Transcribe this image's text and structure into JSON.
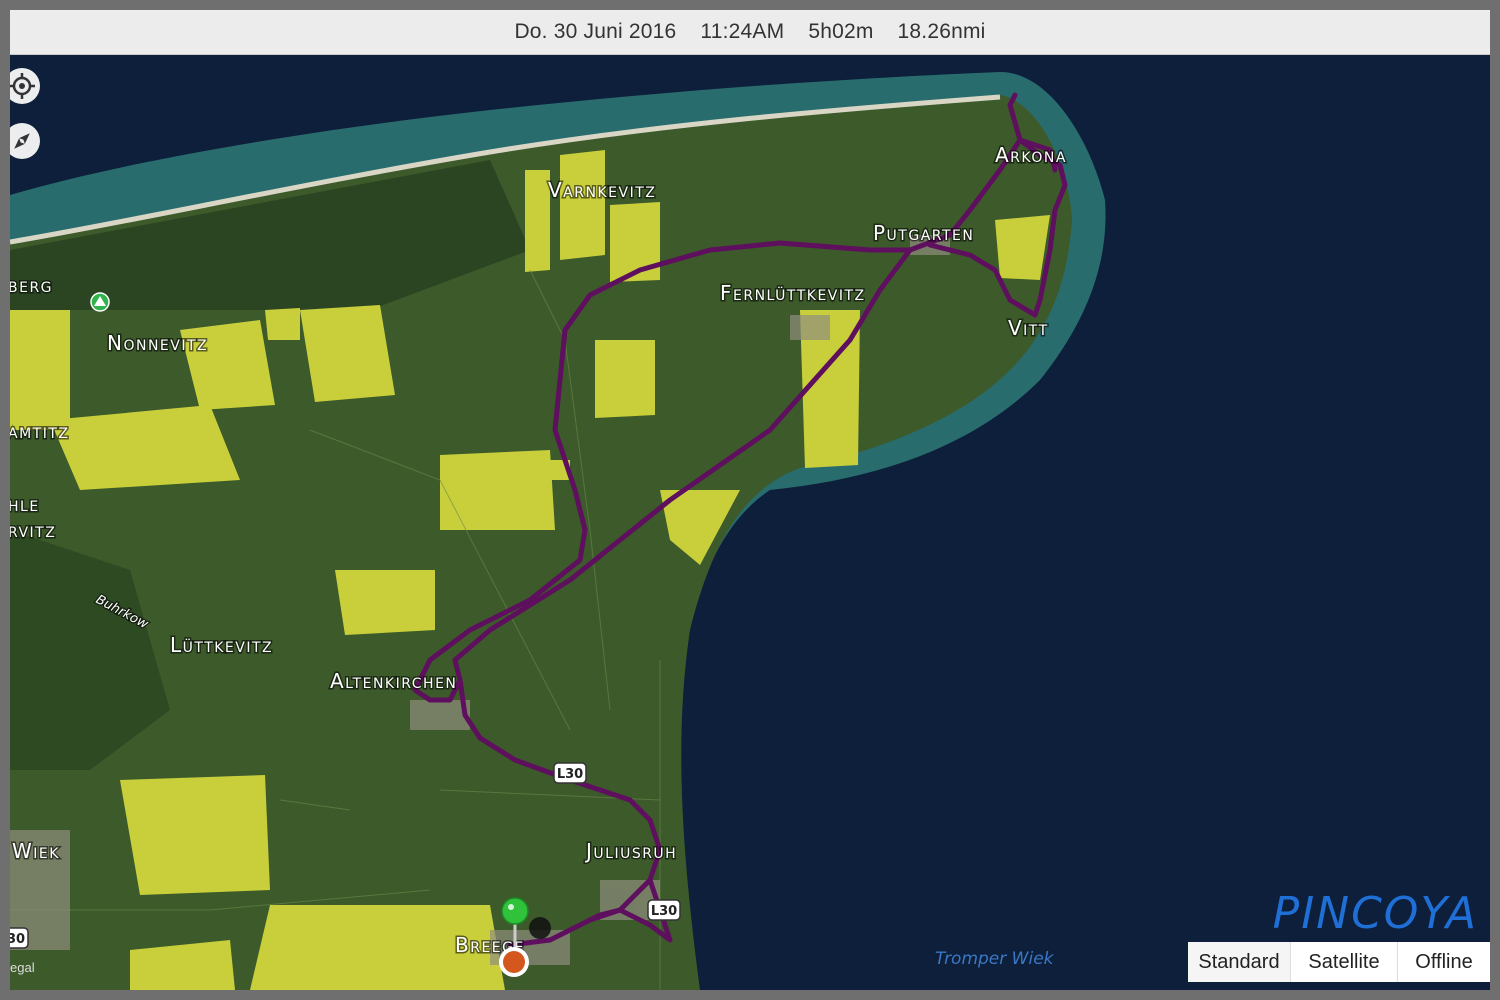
{
  "status": {
    "date": "Do. 30 Juni 2016",
    "time": "11:24AM",
    "duration": "5h02m",
    "distance": "18.26nmi"
  },
  "places": {
    "varnkevitz": "Varnkevitz",
    "arkona": "Arkona",
    "putgarten": "Putgarten",
    "fernluettkevitz": "Fernlüttkevitz",
    "vitt": "Vitt",
    "berg": "berg",
    "nonnevitz": "Nonnevitz",
    "amtitz": "amtitz",
    "hle": "hle",
    "rvitz": "rvitz",
    "luettkevitz": "Lüttkevitz",
    "altenkirchen": "Altenkirchen",
    "wiek": "Wiek",
    "juliusruh": "Juliusruh",
    "breege": "Breege"
  },
  "roads": {
    "buhrkow": "Buhrkow",
    "l30_a": "L30",
    "l30_b": "L30",
    "r30": "30"
  },
  "water_label": "Tromper Wiek",
  "legal": "egal",
  "watermark": "PINCOYA",
  "map_types": {
    "standard": "Standard",
    "satellite": "Satellite",
    "offline": "Offline",
    "selected": "Standard"
  },
  "icons": {
    "locate": "locate-icon",
    "compass": "compass-icon",
    "start_pin": "start-pin-icon",
    "end_marker": "end-marker-icon",
    "campground": "campground-icon"
  },
  "colors": {
    "track": "#5e0f5e",
    "water_deep": "#0d1f3a",
    "water_shallow": "#3f8f8a",
    "land": "#3f5a2a",
    "rapeseed": "#c9cf3a",
    "start_pin": "#2fc23a",
    "end_marker": "#d4571e",
    "watermark": "#1f6fd6"
  }
}
